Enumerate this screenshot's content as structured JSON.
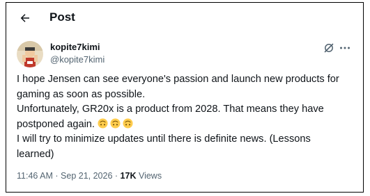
{
  "header": {
    "title": "Post",
    "back_icon": "arrow-left-icon"
  },
  "author": {
    "name": "kopite7kimi",
    "handle": "@kopite7kimi",
    "avatar_icon": "avatar-image"
  },
  "actions": {
    "grok_icon": "grok-icon",
    "more_icon": "more-dots-icon",
    "more_label": "···"
  },
  "tweet": {
    "line1": "I hope Jensen can see everyone's passion and launch new products for",
    "line2": "gaming as soon as possible.",
    "line3": "Unfortunately, GR20x is a product from 2028. That means they have",
    "line4": "postponed again.",
    "emoji_name": "upside-down-face-emoji",
    "emoji_count": 3,
    "line5": "I will try to minimize updates until there is definite news. (Lessons",
    "line6": "learned)"
  },
  "meta": {
    "time": "11:46 AM",
    "separator": "·",
    "date": "Sep 21, 2026",
    "views_count": "17K",
    "views_label": "Views"
  },
  "colors": {
    "text_primary": "#0f1419",
    "text_secondary": "#536471",
    "emoji_yellow": "#ffcc4d",
    "border": "#000000"
  }
}
